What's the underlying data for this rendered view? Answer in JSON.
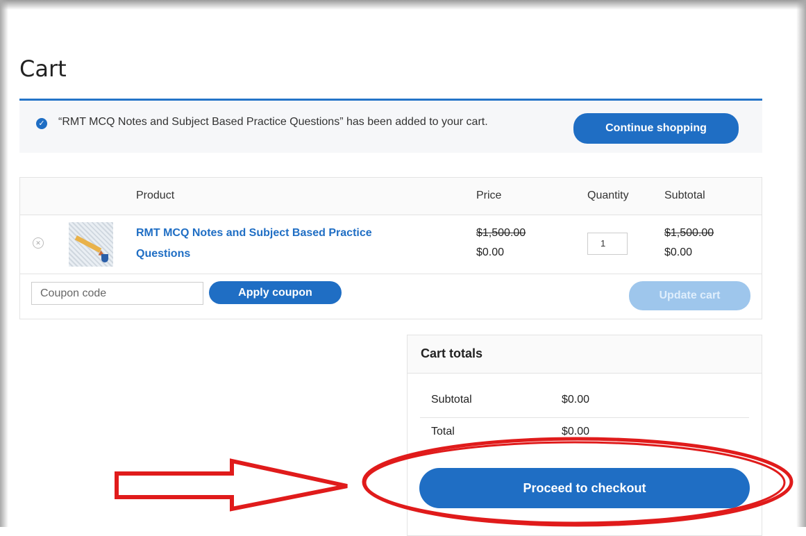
{
  "page": {
    "title": "Cart"
  },
  "notice": {
    "message": "“RMT MCQ Notes and Subject Based Practice Questions” has been added to your cart.",
    "continue_label": "Continue shopping"
  },
  "table": {
    "headers": {
      "product": "Product",
      "price": "Price",
      "quantity": "Quantity",
      "subtotal": "Subtotal"
    },
    "item": {
      "name": "RMT MCQ Notes and Subject Based Practice Questions",
      "price_old": "$1,500.00",
      "price_new": "$0.00",
      "quantity": "1",
      "subtotal_old": "$1,500.00",
      "subtotal_new": "$0.00"
    },
    "coupon_placeholder": "Coupon code",
    "apply_label": "Apply coupon",
    "update_label": "Update cart"
  },
  "totals": {
    "title": "Cart totals",
    "subtotal_label": "Subtotal",
    "subtotal_value": "$0.00",
    "total_label": "Total",
    "total_value": "$0.00",
    "checkout_label": "Proceed to checkout"
  },
  "colors": {
    "accent": "#1f6ec4",
    "annotation": "#e01b1b",
    "disabled": "#9ec6ec"
  },
  "icons": {
    "notice": "check-circle-icon",
    "remove": "remove-circle-icon",
    "arrow": "red-arrow-annotation"
  }
}
